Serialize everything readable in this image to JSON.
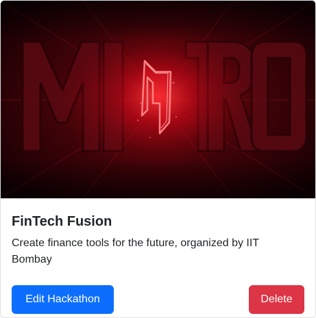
{
  "hackathon": {
    "title": "FinTech Fusion",
    "description": "Create finance tools for the future, organized by IIT Bombay",
    "banner_image": "mitro-logo-banner",
    "banner_text": "MITRO"
  },
  "actions": {
    "edit_label": "Edit Hackathon",
    "delete_label": "Delete"
  },
  "colors": {
    "primary": "#0d6efd",
    "danger": "#dc3545",
    "banner_red": "#c4121c"
  }
}
